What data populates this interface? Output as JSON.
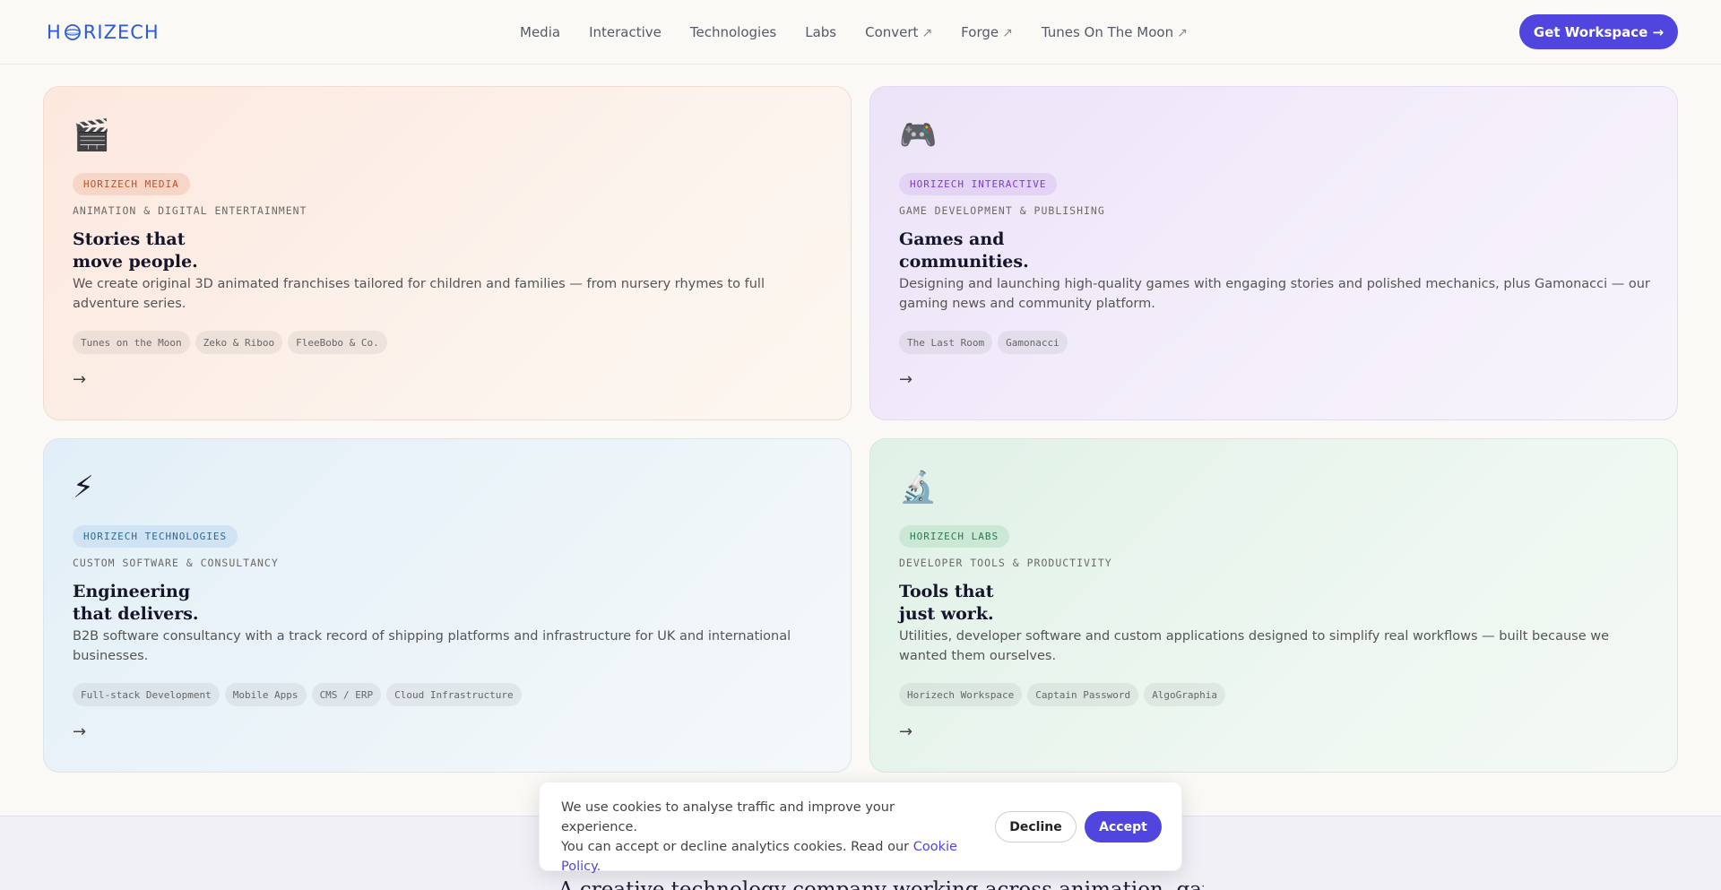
{
  "header": {
    "logo_left": "H",
    "logo_right": "RIZECH",
    "nav": [
      {
        "label": "Media",
        "external": false
      },
      {
        "label": "Interactive",
        "external": false
      },
      {
        "label": "Technologies",
        "external": false
      },
      {
        "label": "Labs",
        "external": false
      },
      {
        "label": "Convert",
        "external": true
      },
      {
        "label": "Forge",
        "external": true
      },
      {
        "label": "Tunes On The Moon",
        "external": true
      }
    ],
    "external_icon": "↗",
    "cta_label": "Get Workspace →"
  },
  "cards": [
    {
      "icon": "🎬",
      "icon_name": "clapperboard-icon",
      "badge": "HORIZECH MEDIA",
      "kicker": "ANIMATION & DIGITAL ENTERTAINMENT",
      "headline_1": "Stories that",
      "headline_2": "move people.",
      "description": "We create original 3D animated franchises tailored for children and families — from nursery rhymes to full adventure series.",
      "tags": [
        "Tunes on the Moon",
        "Zeko & Riboo",
        "FleeBobo & Co."
      ],
      "arrow": "→"
    },
    {
      "icon": "🎮",
      "icon_name": "gamepad-icon",
      "badge": "HORIZECH INTERACTIVE",
      "kicker": "GAME DEVELOPMENT & PUBLISHING",
      "headline_1": "Games and",
      "headline_2": "communities.",
      "description": "Designing and launching high-quality games with engaging stories and polished mechanics, plus Gamonacci — our gaming news and community platform.",
      "tags": [
        "The Last Room",
        "Gamonacci"
      ],
      "arrow": "→"
    },
    {
      "icon": "⚡",
      "icon_name": "lightning-icon",
      "badge": "HORIZECH TECHNOLOGIES",
      "kicker": "CUSTOM SOFTWARE & CONSULTANCY",
      "headline_1": "Engineering",
      "headline_2": "that delivers.",
      "description": "B2B software consultancy with a track record of shipping platforms and infrastructure for UK and international businesses.",
      "tags": [
        "Full-stack Development",
        "Mobile Apps",
        "CMS / ERP",
        "Cloud Infrastructure"
      ],
      "arrow": "→"
    },
    {
      "icon": "🔬",
      "icon_name": "microscope-icon",
      "badge": "HORIZECH LABS",
      "kicker": "DEVELOPER TOOLS & PRODUCTIVITY",
      "headline_1": "Tools that",
      "headline_2": "just work.",
      "description": "Utilities, developer software and custom applications designed to simplify real workflows — built because we wanted them ourselves.",
      "tags": [
        "Horizech Workspace",
        "Captain Password",
        "AlgoGraphia"
      ],
      "arrow": "→"
    }
  ],
  "tagline": "A creative technology company working across animation, gaming",
  "cookie": {
    "line1": "We use cookies to analyse traffic and improve your experience.",
    "line2": "You can accept or decline analytics cookies. Read our ",
    "link": "Cookie Policy",
    "link_suffix": ".",
    "decline": "Decline",
    "accept": "Accept"
  }
}
